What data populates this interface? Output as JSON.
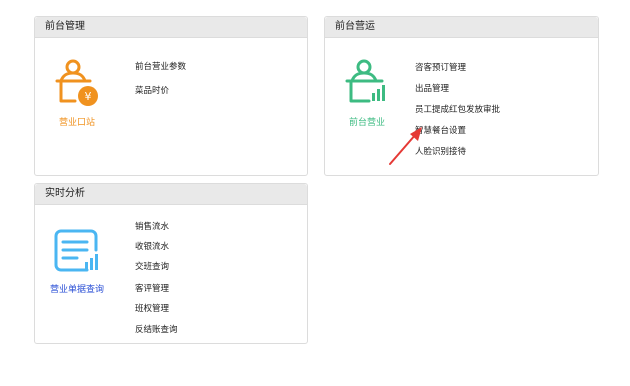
{
  "panels": {
    "front_management": {
      "title": "前台管理",
      "tile_caption": "营业口站",
      "tile_color": "#f0921f",
      "links": [
        "前台营业参数",
        "菜品时价"
      ]
    },
    "front_operations": {
      "title": "前台营运",
      "tile_caption": "前台营业",
      "tile_color": "#3dbb82",
      "links": [
        "咨客预订管理",
        "出品管理",
        "员工提成红包发放审批",
        "智慧餐台设置",
        "人脸识别接待"
      ]
    },
    "realtime_analysis": {
      "title": "实时分析",
      "tile_caption": "营业单据查询",
      "tile_color": "#4ab6f2",
      "caption_color": "#2a4fd6",
      "links": [
        "销售流水",
        "收银流水",
        "交班查询",
        "客评管理",
        "班权管理",
        "反结账查询"
      ]
    }
  },
  "annotation": {
    "arrow_color": "#e53935",
    "icon": "pointer-arrow-icon"
  }
}
